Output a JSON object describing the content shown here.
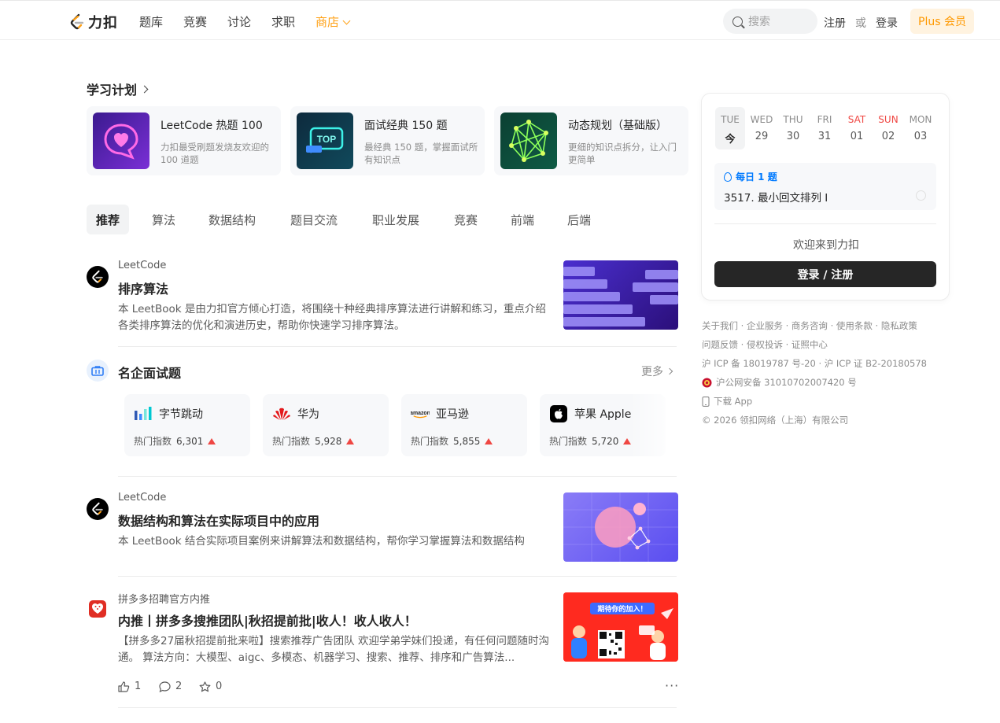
{
  "brand": {
    "logo_text": "力扣"
  },
  "nav": {
    "items": [
      "题库",
      "竞赛",
      "讨论",
      "求职"
    ],
    "store_label": "商店",
    "search_placeholder": "搜索",
    "register": "注册",
    "or": "或",
    "login": "登录",
    "plus": "Plus 会员"
  },
  "study": {
    "title": "学习计划",
    "cards": [
      {
        "title": "LeetCode 热题 100",
        "desc": "力扣最受刷题发烧友欢迎的 100 道题"
      },
      {
        "title": "面试经典 150 题",
        "desc": "最经典 150 题，掌握面试所有知识点",
        "badge": "TOP"
      },
      {
        "title": "动态规划（基础版）",
        "desc": "更细的知识点拆分，让入门更简单"
      }
    ]
  },
  "tabs": [
    "推荐",
    "算法",
    "数据结构",
    "题目交流",
    "职业发展",
    "竞赛",
    "前端",
    "后端"
  ],
  "feed": [
    {
      "author": "LeetCode",
      "title": "排序算法",
      "summary": "本 LeetBook 是由力扣官方倾心打造，将围绕十种经典排序算法进行讲解和练习，重点介绍各类排序算法的优化和演进历史，帮助你快速学习排序算法。"
    },
    {
      "author": "LeetCode",
      "title": "数据结构和算法在实际项目中的应用",
      "summary": "本 LeetBook 结合实际项目案例来讲解算法和数据结构，帮你学习掌握算法和数据结构"
    },
    {
      "author": "拼多多招聘官方内推",
      "title": "内推丨拼多多搜推团队|秋招提前批|收人！收人收人！",
      "summary": "【拼多多27届秋招提前批来啦】搜索推荐广告团队 欢迎学弟学妹们投递，有任何问题随时沟通。 算法方向：大模型、aigc、多模态、机器学习、搜索、推荐、排序和广告算法...",
      "banner": "期待你的加入！",
      "likes": "1",
      "comments": "2",
      "stars": "0"
    }
  ],
  "companies": {
    "title": "名企面试题",
    "more": "更多",
    "hot_label": "热门指数",
    "items": [
      {
        "name": "字节跳动",
        "hot": "6,301"
      },
      {
        "name": "华为",
        "hot": "5,928"
      },
      {
        "name": "亚马逊",
        "hot": "5,855",
        "logo_text": "amazon"
      },
      {
        "name": "苹果 Apple",
        "hot": "5,720"
      }
    ]
  },
  "calendar": {
    "days": [
      {
        "name": "TUE",
        "date": "今"
      },
      {
        "name": "WED",
        "date": "29"
      },
      {
        "name": "THU",
        "date": "30"
      },
      {
        "name": "FRI",
        "date": "31"
      },
      {
        "name": "SAT",
        "date": "01"
      },
      {
        "name": "SUN",
        "date": "02"
      },
      {
        "name": "MON",
        "date": "03"
      }
    ],
    "daily_tag": "每日 1 题",
    "daily_question": "3517. 最小回文排列 I",
    "welcome": "欢迎来到力扣",
    "login_register": "登录 / 注册"
  },
  "footer": {
    "line1": "关于我们 · 企业服务 · 商务咨询 · 使用条款 · 隐私政策",
    "line2": "问题反馈 · 侵权投诉 · 证照中心",
    "line3": "沪 ICP 备 18019787 号-20 · 沪 ICP 证 B2-20180578",
    "line4": "沪公网安备 31010702007420 号",
    "line5": "下载 App",
    "line6": "©  2026 领扣网络（上海）有限公司"
  },
  "colors": {
    "accent": "#ffa116",
    "up": "#ef4743",
    "link": "#007aff"
  }
}
